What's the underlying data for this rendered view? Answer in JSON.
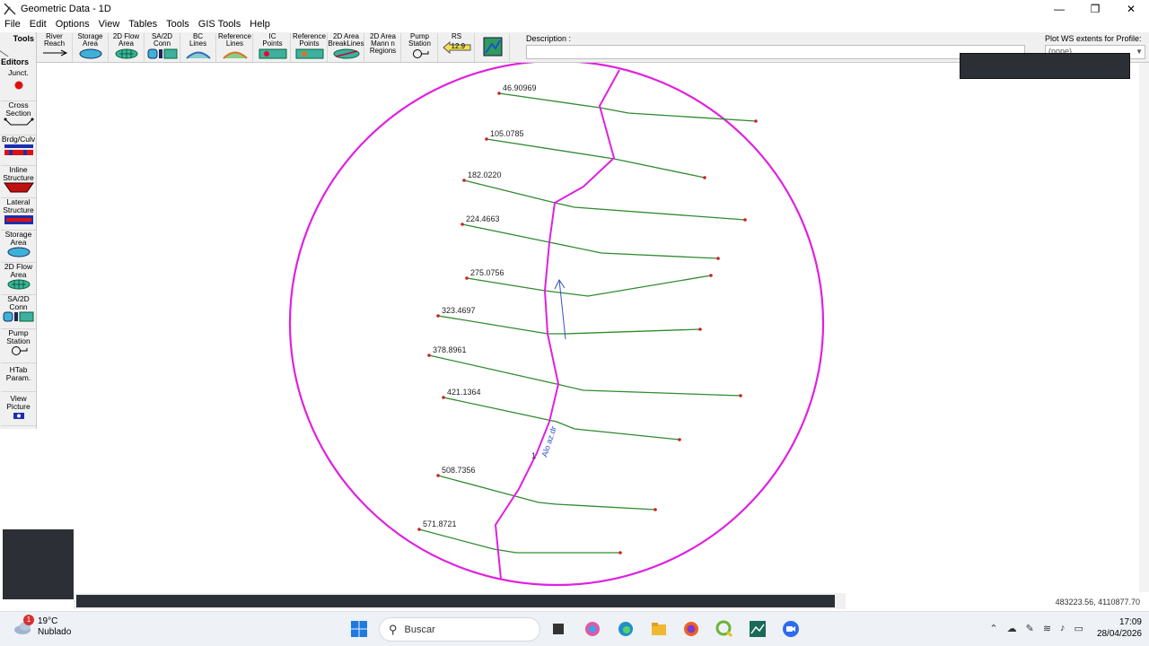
{
  "window": {
    "title": "Geometric Data - 1D",
    "minimize": "—",
    "maximize": "❐",
    "close": "✕"
  },
  "menu": [
    "File",
    "Edit",
    "Options",
    "View",
    "Tables",
    "Tools",
    "GIS Tools",
    "Help"
  ],
  "toolbar": {
    "corner_label": "Tools",
    "buttons": [
      {
        "label": "River\nReach"
      },
      {
        "label": "Storage\nArea"
      },
      {
        "label": "2D Flow\nArea"
      },
      {
        "label": "SA/2D\nConn"
      },
      {
        "label": "BC\nLines"
      },
      {
        "label": "Reference\nLines"
      },
      {
        "label": "IC\nPoints"
      },
      {
        "label": "Reference\nPoints"
      },
      {
        "label": "2D Area\nBreakLines"
      },
      {
        "label": "2D Area\nMann n\nRegions"
      },
      {
        "label": "Pump\nStation"
      },
      {
        "label": "RS"
      }
    ],
    "rs_value": "12.9",
    "description_label": "Description :",
    "description_value": "",
    "plot_label": "Plot WS extents for Profile:",
    "plot_value": "(none)"
  },
  "editors": {
    "title": "Editors",
    "buttons": [
      {
        "label": "Junct."
      },
      {
        "label": "Cross\nSection"
      },
      {
        "label": "Brdg/Culv"
      },
      {
        "label": "Inline\nStructure"
      },
      {
        "label": "Lateral\nStructure"
      },
      {
        "label": "Storage\nArea"
      },
      {
        "label": "2D Flow\nArea"
      },
      {
        "label": "SA/2D\nConn"
      },
      {
        "label": "Pump\nStation"
      },
      {
        "label": "HTab\nParam."
      },
      {
        "label": "View\nPicture"
      }
    ]
  },
  "map": {
    "river_label": "Alo az.dr",
    "reach_label": "1",
    "cross_sections": [
      "46.90969",
      "105.0785",
      "182.0220",
      "224.4663",
      "275.0756",
      "323.4697",
      "378.8961",
      "421.1364",
      "508.7356",
      "571.8721"
    ],
    "colors": {
      "circle": "#e020e0",
      "xs": "#2f8a2f",
      "xs_end": "#cc2222",
      "river": "#3050c0"
    }
  },
  "status": {
    "coords": "483223.56, 4110877.70"
  },
  "taskbar": {
    "weather_temp": "19°C",
    "weather_desc": "Nublado",
    "weather_badge": "1",
    "search_placeholder": "Buscar",
    "time": "17:09",
    "date": "28/04/2026"
  }
}
